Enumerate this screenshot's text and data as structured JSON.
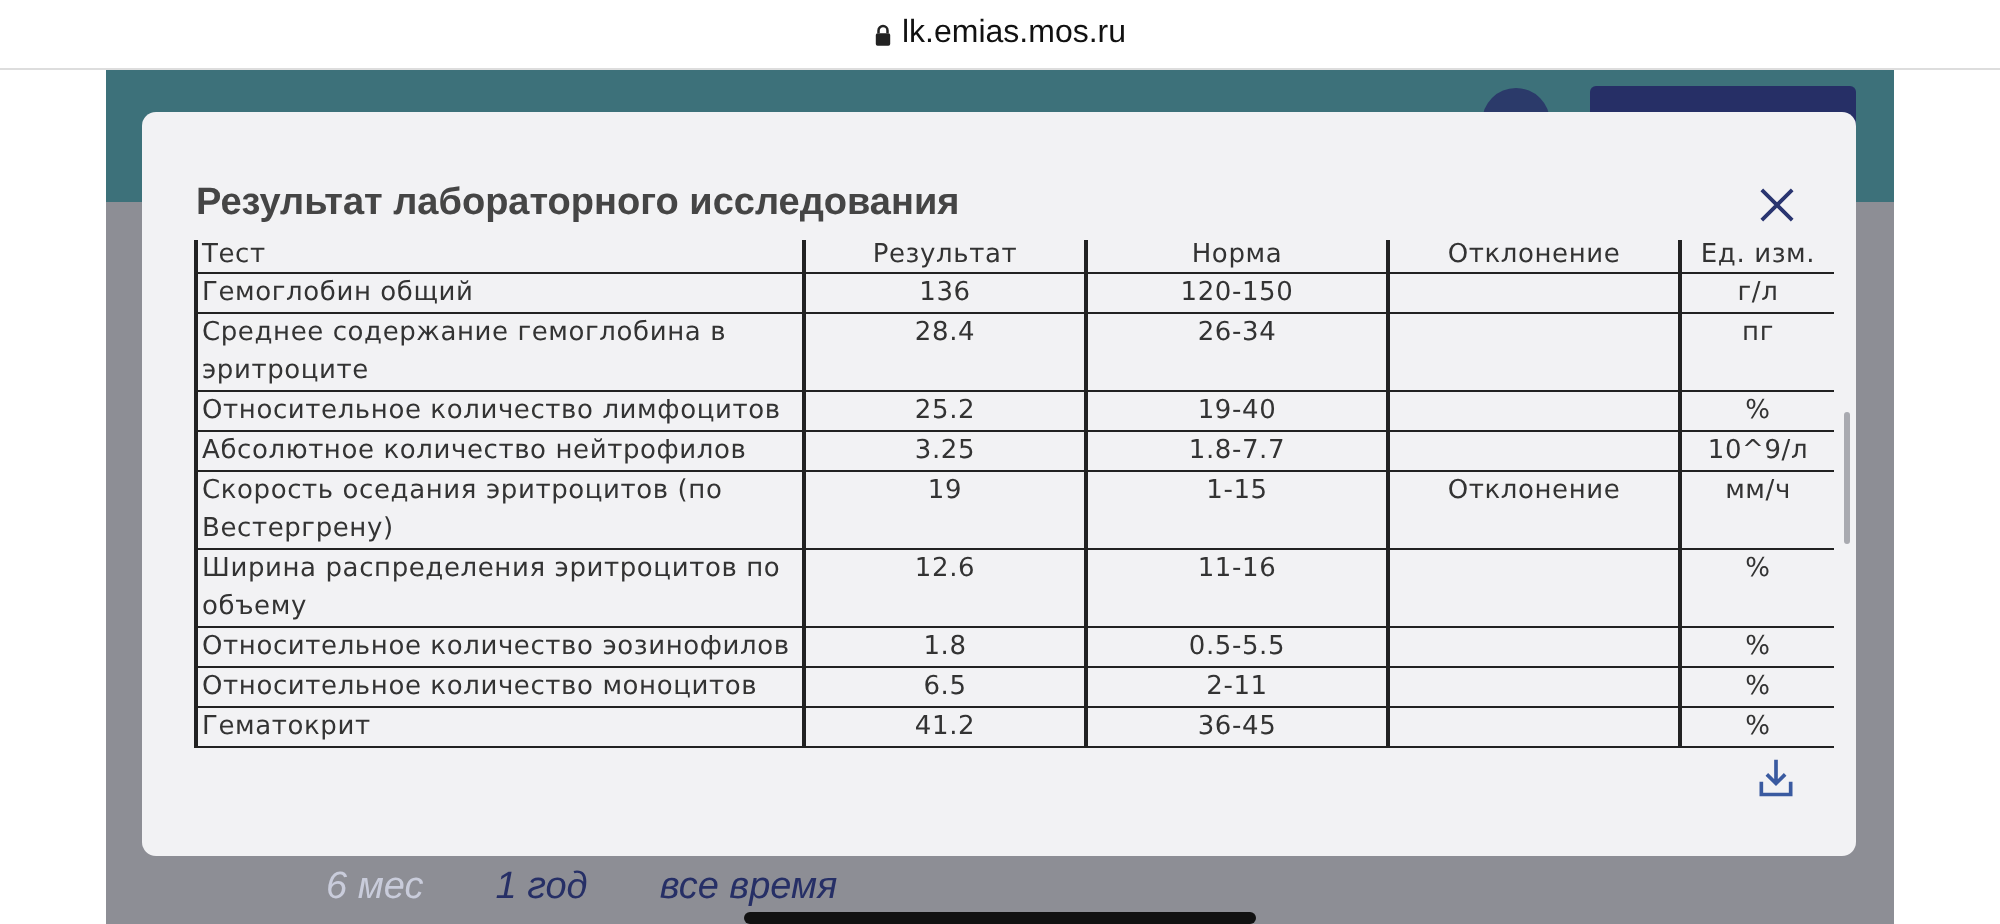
{
  "browser_bar": {
    "url": "lk.emias.mos.ru"
  },
  "modal": {
    "title": "Результат лабораторного исследования",
    "table": {
      "columns": [
        "Тест",
        "Результат",
        "Норма",
        "Отклонение",
        "Ед. изм."
      ],
      "rows": [
        [
          "Гемоглобин общий",
          "136",
          "120-150",
          "",
          "г/л"
        ],
        [
          "Среднее содержание гемоглобина в эритроците",
          "28.4",
          "26-34",
          "",
          "пг"
        ],
        [
          "Относительное количество лимфоцитов",
          "25.2",
          "19-40",
          "",
          "%"
        ],
        [
          "Абсолютное количество нейтрофилов",
          "3.25",
          "1.8-7.7",
          "",
          "10^9/л"
        ],
        [
          "Скорость оседания эритроцитов (по Вестергрену)",
          "19",
          "1-15",
          "Отклонение",
          "мм/ч"
        ],
        [
          "Ширина распределения эритроцитов по объему",
          "12.6",
          "11-16",
          "",
          "%"
        ],
        [
          "Относительное количество эозинофилов",
          "1.8",
          "0.5-5.5",
          "",
          "%"
        ],
        [
          "Относительное количество моноцитов",
          "6.5",
          "2-11",
          "",
          "%"
        ],
        [
          "Гематокрит",
          "41.2",
          "36-45",
          "",
          "%"
        ]
      ]
    }
  },
  "period_tabs": [
    {
      "label": "6 мес",
      "disabled": true
    },
    {
      "label": "1 год",
      "disabled": false
    },
    {
      "label": "все время",
      "disabled": false
    }
  ]
}
